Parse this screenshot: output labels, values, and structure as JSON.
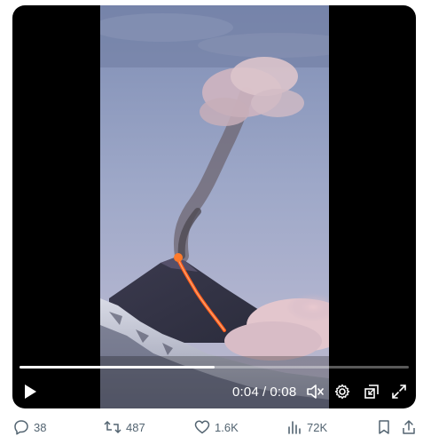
{
  "player": {
    "current_time": "0:04",
    "separator": "/",
    "duration": "0:08",
    "progress": 0.5,
    "icons": {
      "play": "play-icon",
      "mute": "volume-muted-icon",
      "settings": "gear-icon",
      "pip": "picture-in-picture-icon",
      "fullscreen": "fullscreen-icon"
    }
  },
  "actions": {
    "replies": "38",
    "reposts": "487",
    "likes": "1.6K",
    "views": "72K"
  },
  "colors": {
    "action_gray": "#536471",
    "player_bg": "#000000",
    "lava": "#ff5a1a"
  }
}
